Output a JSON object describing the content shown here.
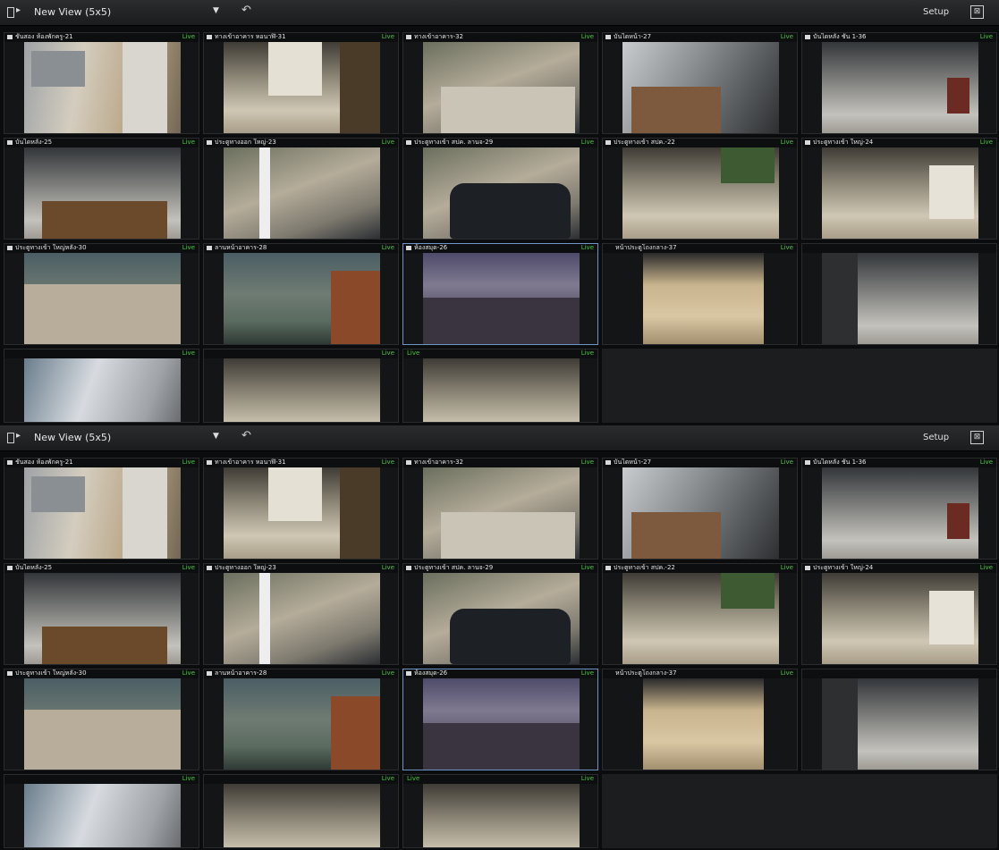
{
  "toolbar": {
    "view_title": "New View (5x5)",
    "dropdown_glyph": "▼",
    "undo_glyph": "↶",
    "setup_label": "Setup",
    "close_glyph": "⊠"
  },
  "live_label": "Live",
  "cameras": [
    {
      "name": "ชั้นสอง ห้องพักครู-21"
    },
    {
      "name": "ทางเข้าอาคาร หอนาฬิ-31"
    },
    {
      "name": "ทางเข้าอาคาร-32"
    },
    {
      "name": "บันไดหน้า-27"
    },
    {
      "name": "บันไดหลัง ชั้น 1-36"
    },
    {
      "name": "บันไดหลัง-25"
    },
    {
      "name": "ประตูทางออก ใหญ่-23"
    },
    {
      "name": "ประตูทางเข้า สปค. ลานจ-29"
    },
    {
      "name": "ประตูทางเข้า สปค.-22"
    },
    {
      "name": "ประตูทางเข้า ใหญ่-24"
    },
    {
      "name": "ประตูทางเข้า ใหญ่หลัง-30"
    },
    {
      "name": "ลานหน้าอาคาร-28"
    },
    {
      "name": "ห้องสมุด-26"
    },
    {
      "name": "หน้าประตูโถงกลาง-37"
    },
    {
      "name": ""
    }
  ],
  "colors": {
    "live": "#41c53a",
    "selection": "#6f95c8",
    "toolbar": "#2a2c2e"
  }
}
